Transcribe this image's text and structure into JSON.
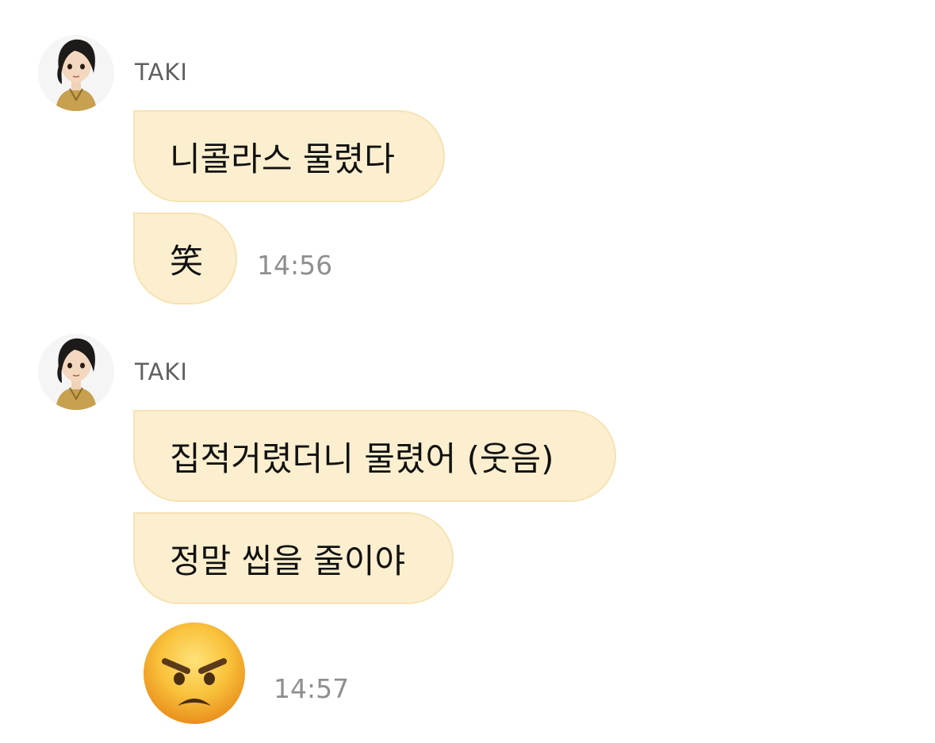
{
  "messages": [
    {
      "sender": "TAKI",
      "avatar_icon": "taki-avatar-icon",
      "bubbles": [
        "니콜라스 물렸다",
        "笑"
      ],
      "time": "14:56"
    },
    {
      "sender": "TAKI",
      "avatar_icon": "taki-avatar-icon",
      "bubbles": [
        "집적거렸더니 물렸어 (웃음)",
        "정말 씹을 줄이야"
      ],
      "sticker": "angry-face-emoji",
      "time": "14:57"
    }
  ],
  "colors": {
    "bubble": "#fcefcf",
    "bubble_border": "#f6e3b3",
    "timestamp": "#8f8f8f",
    "sender": "#5f5f5f"
  }
}
